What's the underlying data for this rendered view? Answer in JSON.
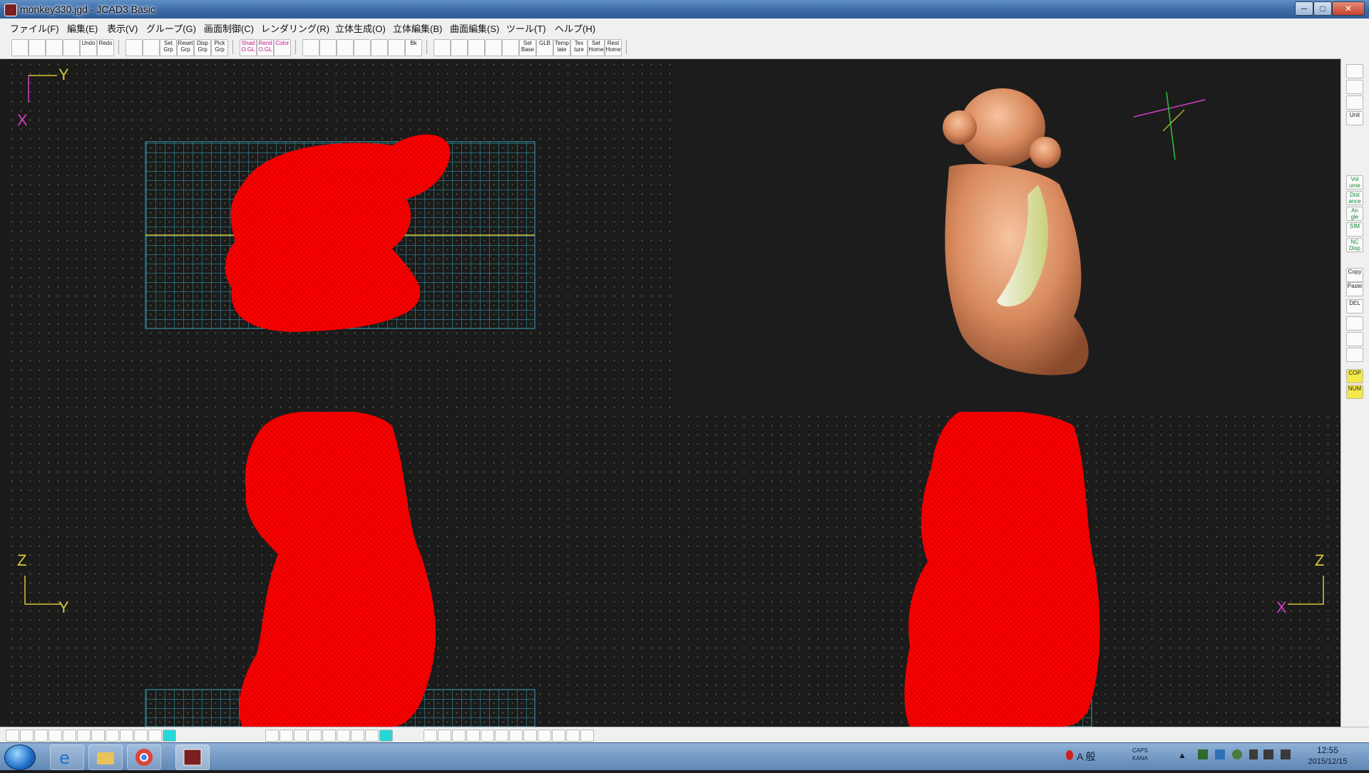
{
  "window": {
    "title": "monkey330.jgd - JCAD3 Basic",
    "controls": [
      "─",
      "□",
      "✕"
    ]
  },
  "menu": [
    "ファイル(F)",
    "編集(E)",
    "表示(V)",
    "グループ(G)",
    "画面制御(C)",
    "レンダリング(R)",
    "立体生成(O)",
    "立体編集(B)",
    "曲面編集(S)",
    "ツール(T)",
    "ヘルプ(H)"
  ],
  "toolbar": {
    "groups": [
      [
        "",
        "",
        "",
        "",
        "Undo",
        "Redo"
      ],
      [
        "",
        "",
        "Set Grp",
        "Reset Grp",
        "Disp Grp",
        "Pick Grp"
      ],
      [
        "Shad O.GL",
        "Rend O.GL",
        "Color"
      ],
      [
        "",
        "",
        "",
        "",
        "",
        "",
        "Bk"
      ],
      [
        "",
        "",
        "",
        "",
        "",
        "Set Base",
        "GLB",
        "Temp late",
        "Tex ture",
        "Set Home",
        "Rest Home"
      ]
    ]
  },
  "viewports": {
    "top_left": {
      "axis_v": "X",
      "axis_h": "Y",
      "view": "top"
    },
    "top_right": {
      "view": "perspective-render"
    },
    "bottom_left": {
      "axis_v": "Z",
      "axis_h": "Y",
      "view": "front"
    },
    "bottom_right": {
      "axis_v": "Z",
      "axis_h": "X",
      "view": "side"
    }
  },
  "right_panel": [
    "",
    "",
    "",
    "Unit",
    "Vol ume",
    "Dist ance",
    "An gle",
    "SIM",
    "NC Disp",
    "Copy",
    "Paste",
    "DEL",
    "",
    "",
    "",
    "COP",
    "NUM"
  ],
  "taskbar": {
    "clock_time": "12:55",
    "clock_date": "2015/12/15",
    "ime": "A 般",
    "caps": "CAPS",
    "kana": "KANA"
  },
  "colors": {
    "wireframe": "#ff0000",
    "grid": "#3aa7b8",
    "axis_yellow": "#d8c837",
    "axis_magenta": "#d23ec9",
    "render_copper": "#d98a5e"
  }
}
